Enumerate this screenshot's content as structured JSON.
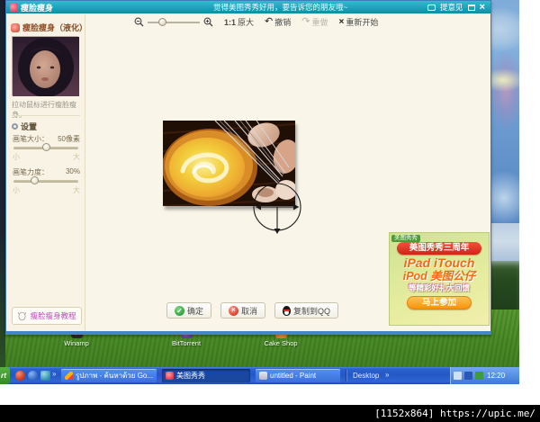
{
  "titlebar": {
    "title": "瘦脸瘦身",
    "message": "觉得美图秀秀好用，要告诉您的朋友哦~",
    "feedback": "提意见",
    "close": "×"
  },
  "toolbar": {
    "actual_ratio": "1:1",
    "actual_label": "原大",
    "undo_glyph": "↶",
    "undo": "撤销",
    "redo_glyph": "↷",
    "redo": "重做",
    "restart_glyph": "×",
    "restart": "重新开始"
  },
  "sidebar": {
    "header": "瘦脸瘦身（液化）",
    "instruction": "拉动鼠标进行瘦脸瘦身。",
    "settings": "设置",
    "brush_size": {
      "label": "画笔大小：",
      "value": "50像素",
      "min": "小",
      "max": "大"
    },
    "brush_strength": {
      "label": "画笔力度：",
      "value": "30%",
      "min": "小",
      "max": "大"
    },
    "tutorial": "瘦脸瘦身教程"
  },
  "actions": {
    "ok_glyph": "✓",
    "ok": "确定",
    "cancel_glyph": "×",
    "cancel": "取消",
    "copy_qq": "复制到QQ"
  },
  "ad": {
    "tag": "美图秀秀",
    "banner": "美图秀秀三周年",
    "line1": "iPad iTouch",
    "line2": "iPod 美图公仔",
    "line3": "等精彩好礼大回馈",
    "button": "马上参加"
  },
  "desktop_icons": [
    {
      "label": "Winamp"
    },
    {
      "label": "BitTorrent"
    },
    {
      "label": "Cake Shop"
    }
  ],
  "taskbar": {
    "start_fragment": "rt",
    "quicklaunch_more": "»",
    "tasks": [
      {
        "label": "รูปภาพ - ค้นหาด้วย Go..."
      },
      {
        "label": "美图秀秀"
      },
      {
        "label": "untitled - Paint"
      }
    ],
    "desktop_label": "Desktop",
    "desktop_more": "»",
    "clock": "12:20"
  },
  "watermark": {
    "text": "[1152x864] https://upic.me/"
  }
}
